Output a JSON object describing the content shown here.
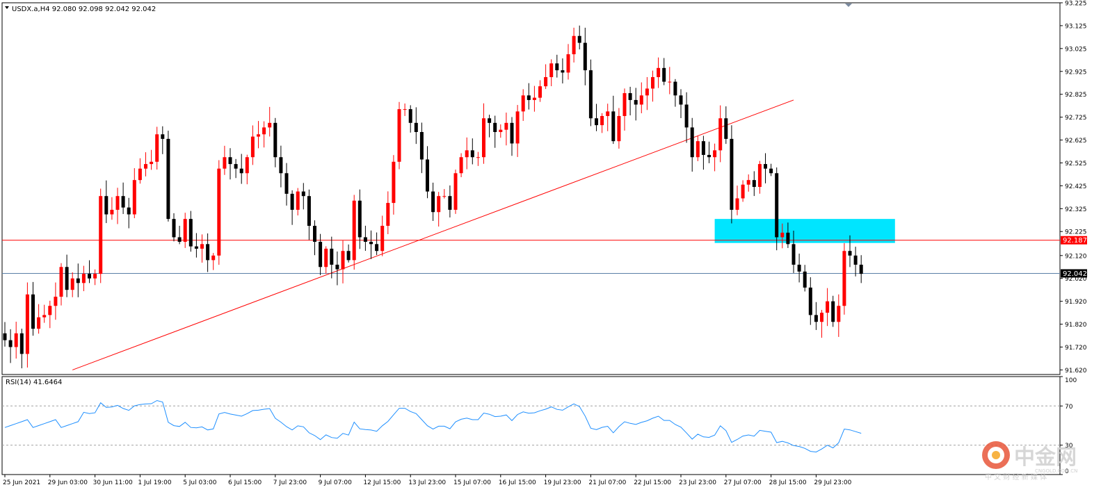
{
  "chart_data": {
    "type": "candlestick",
    "symbol_info": "USDX.a,H4  92.080 92.098 92.042 92.042",
    "last_price_label": "92.042",
    "level_label": "92.187",
    "level_value": 92.187,
    "last_price": 92.042,
    "ylim": [
      91.6,
      93.225
    ],
    "y_ticks": [
      "93.225",
      "93.125",
      "93.025",
      "92.925",
      "92.825",
      "92.725",
      "92.625",
      "92.525",
      "92.425",
      "92.325",
      "92.225",
      "92.120",
      "92.020",
      "91.920",
      "91.820",
      "91.720",
      "91.620"
    ],
    "y_tick_values": [
      93.225,
      93.125,
      93.025,
      92.925,
      92.825,
      92.725,
      92.625,
      92.525,
      92.425,
      92.325,
      92.225,
      92.12,
      92.02,
      91.92,
      91.82,
      91.72,
      91.62
    ],
    "x_labels": [
      "25 Jun 2021",
      "29 Jun 03:00",
      "30 Jun 11:00",
      "1 Jul 19:00",
      "5 Jul 03:00",
      "6 Jul 15:00",
      "7 Jul 23:00",
      "9 Jul 07:00",
      "12 Jul 15:00",
      "13 Jul 23:00",
      "15 Jul 07:00",
      "16 Jul 15:00",
      "19 Jul 23:00",
      "21 Jul 07:00",
      "22 Jul 15:00",
      "23 Jul 23:00",
      "27 Jul 07:00",
      "28 Jul 15:00",
      "29 Jul 23:00"
    ],
    "x_label_bars": [
      0,
      8,
      16,
      24,
      32,
      40,
      48,
      56,
      64,
      72,
      80,
      88,
      96,
      104,
      112,
      120,
      128,
      136,
      144
    ],
    "closes": [
      91.75,
      91.72,
      91.78,
      91.69,
      91.95,
      91.8,
      91.85,
      91.86,
      91.9,
      91.94,
      92.07,
      91.97,
      92.02,
      92.0,
      92.04,
      92.02,
      92.04,
      92.38,
      92.3,
      92.32,
      92.38,
      92.33,
      92.3,
      92.45,
      92.5,
      92.52,
      92.53,
      92.65,
      92.63,
      92.28,
      92.2,
      92.18,
      92.28,
      92.16,
      92.15,
      92.17,
      92.1,
      92.12,
      92.5,
      92.55,
      92.52,
      92.5,
      92.48,
      92.55,
      92.64,
      92.65,
      92.68,
      92.7,
      92.55,
      92.48,
      92.39,
      92.32,
      92.4,
      92.38,
      92.25,
      92.18,
      92.07,
      92.15,
      92.08,
      92.06,
      92.14,
      92.1,
      92.36,
      92.2,
      92.18,
      92.17,
      92.14,
      92.25,
      92.35,
      92.53,
      92.76,
      92.76,
      92.7,
      92.66,
      92.54,
      92.4,
      92.31,
      92.38,
      92.38,
      92.32,
      92.48,
      92.55,
      92.58,
      92.55,
      92.55,
      92.72,
      92.7,
      92.66,
      92.67,
      92.7,
      92.61,
      92.75,
      92.82,
      92.8,
      92.81,
      92.86,
      92.9,
      92.96,
      92.93,
      92.92,
      93.0,
      93.08,
      93.05,
      92.93,
      92.72,
      92.69,
      92.73,
      92.75,
      92.62,
      92.73,
      92.83,
      92.8,
      92.78,
      92.82,
      92.85,
      92.9,
      92.94,
      92.88,
      92.88,
      92.82,
      92.78,
      92.68,
      92.55,
      92.62,
      92.56,
      92.55,
      92.58,
      92.72,
      92.63,
      92.32,
      92.37,
      92.43,
      92.45,
      92.42,
      92.52,
      92.5,
      92.48,
      92.2,
      92.22,
      92.17,
      92.08,
      92.05,
      91.98,
      91.86,
      91.83,
      91.87,
      91.92,
      91.83,
      91.9,
      92.14,
      92.12,
      92.08,
      92.04
    ],
    "rsi": {
      "label": "RSI(14) 41.6464",
      "value": 41.6464,
      "period": 14,
      "levels": [
        70,
        30
      ],
      "ylim": [
        0,
        100
      ],
      "y_ticks": [
        "100",
        "70",
        "30",
        "0"
      ],
      "y_tick_values": [
        100,
        70,
        30,
        0
      ]
    },
    "colors": {
      "bull": "#ff0000",
      "bear": "#000000",
      "trendline": "#ff0000",
      "level": "#ff0000",
      "last_line": "#5a7fa6",
      "zone": "#00e5ff",
      "rsi_line": "#1e8fff",
      "rsi_level": "#a0a0a0"
    },
    "grid": false,
    "legend": "top-left"
  },
  "watermark": {
    "brand": "中金网",
    "domain": "CNGOLD.COM.CN",
    "slogan": "中 文 财 经 新 媒 体"
  }
}
